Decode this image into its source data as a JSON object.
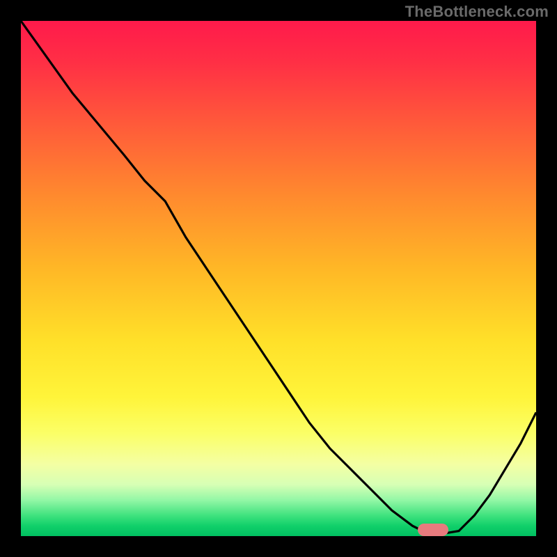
{
  "watermark": "TheBottleneck.com",
  "colors": {
    "frame_bg": "#000000",
    "watermark_text": "#6a6a6a",
    "curve_stroke": "#000000",
    "marker_fill": "#e77b7e",
    "gradient_stops": [
      {
        "offset": 0.0,
        "color": "#ff1a4b"
      },
      {
        "offset": 0.08,
        "color": "#ff2f45"
      },
      {
        "offset": 0.2,
        "color": "#ff5a3a"
      },
      {
        "offset": 0.34,
        "color": "#ff8a2e"
      },
      {
        "offset": 0.48,
        "color": "#ffb726"
      },
      {
        "offset": 0.62,
        "color": "#ffe029"
      },
      {
        "offset": 0.73,
        "color": "#fff43a"
      },
      {
        "offset": 0.8,
        "color": "#fbff66"
      },
      {
        "offset": 0.86,
        "color": "#f4ffa3"
      },
      {
        "offset": 0.9,
        "color": "#d7ffb5"
      },
      {
        "offset": 0.93,
        "color": "#93f7a6"
      },
      {
        "offset": 0.96,
        "color": "#3fe27e"
      },
      {
        "offset": 0.98,
        "color": "#11d06a"
      },
      {
        "offset": 1.0,
        "color": "#00c061"
      }
    ]
  },
  "chart_data": {
    "type": "line",
    "title": "",
    "xlabel": "",
    "ylabel": "",
    "xlim": [
      0,
      100
    ],
    "ylim": [
      0,
      100
    ],
    "x": [
      0,
      5,
      10,
      15,
      20,
      24,
      28,
      32,
      36,
      40,
      44,
      48,
      52,
      56,
      60,
      64,
      68,
      72,
      76,
      78,
      80,
      82,
      85,
      88,
      91,
      94,
      97,
      100
    ],
    "values": [
      100,
      93,
      86,
      80,
      74,
      69,
      65,
      58,
      52,
      46,
      40,
      34,
      28,
      22,
      17,
      13,
      9,
      5,
      2,
      1,
      0.5,
      0.5,
      1,
      4,
      8,
      13,
      18,
      24
    ],
    "marker": {
      "x_start": 77,
      "x_end": 83,
      "y": 1.2
    }
  }
}
